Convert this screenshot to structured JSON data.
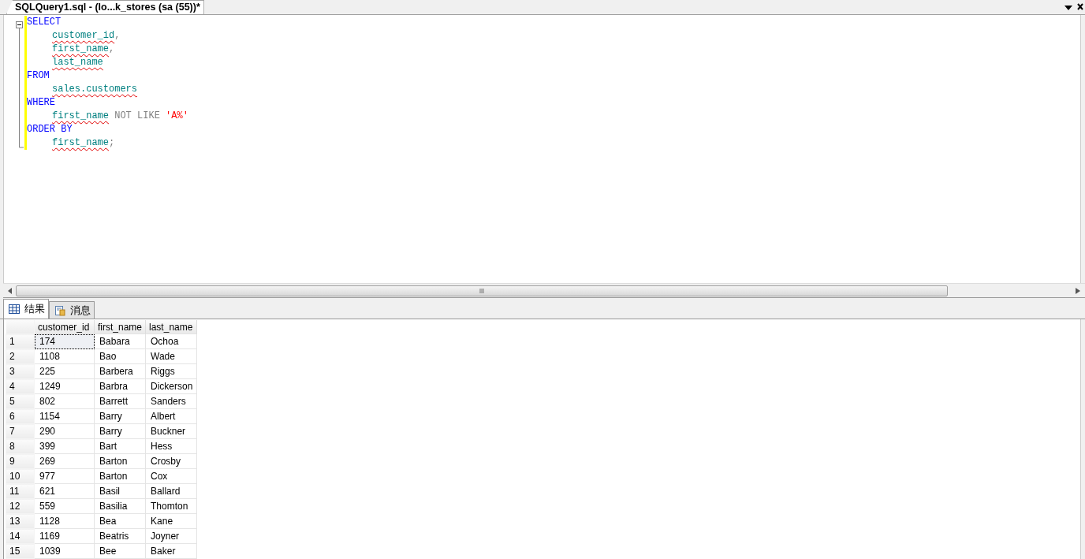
{
  "document_tab": {
    "title": "SQLQuery1.sql - (lo...k_stores (sa (55))*",
    "selected": true
  },
  "editor": {
    "lines": [
      {
        "tokens": [
          {
            "kind": "keyword",
            "text": "SELECT"
          }
        ],
        "children": [
          {
            "tokens": [
              {
                "kind": "identifier",
                "text": "customer_id"
              },
              {
                "kind": "punct",
                "text": ","
              }
            ]
          },
          {
            "tokens": [
              {
                "kind": "identifier",
                "text": "first_name"
              },
              {
                "kind": "punct",
                "text": ","
              }
            ]
          },
          {
            "tokens": [
              {
                "kind": "identifier",
                "text": "last_name"
              }
            ]
          }
        ]
      },
      {
        "tokens": [
          {
            "kind": "keyword",
            "text": "FROM"
          }
        ],
        "children": [
          {
            "tokens": [
              {
                "kind": "identifier",
                "text": "sales.customers"
              }
            ]
          }
        ]
      },
      {
        "tokens": [
          {
            "kind": "keyword",
            "text": "WHERE"
          }
        ],
        "children": [
          {
            "tokens": [
              {
                "kind": "identifier",
                "text": "first_name"
              },
              {
                "kind": "operator",
                "text": " NOT LIKE "
              },
              {
                "kind": "string",
                "text": "'A%'"
              }
            ]
          }
        ]
      },
      {
        "tokens": [
          {
            "kind": "keyword",
            "text": "ORDER BY"
          }
        ],
        "children": [
          {
            "tokens": [
              {
                "kind": "identifier",
                "text": "first_name"
              },
              {
                "kind": "punct",
                "text": ";"
              }
            ]
          }
        ]
      }
    ]
  },
  "result_tabs": [
    {
      "label": "结果",
      "selected": true,
      "kind": "grid"
    },
    {
      "label": "消息",
      "selected": false,
      "kind": "messages"
    }
  ],
  "table": {
    "columns": [
      "customer_id",
      "first_name",
      "last_name"
    ],
    "rows": [
      {
        "number": "1",
        "cells": [
          "174",
          "Babara",
          "Ochoa"
        ],
        "focused": true
      },
      {
        "number": "2",
        "cells": [
          "1108",
          "Bao",
          "Wade"
        ],
        "focused": false
      },
      {
        "number": "3",
        "cells": [
          "225",
          "Barbera",
          "Riggs"
        ],
        "focused": false
      },
      {
        "number": "4",
        "cells": [
          "1249",
          "Barbra",
          "Dickerson"
        ],
        "focused": false
      },
      {
        "number": "5",
        "cells": [
          "802",
          "Barrett",
          "Sanders"
        ],
        "focused": false
      },
      {
        "number": "6",
        "cells": [
          "1154",
          "Barry",
          "Albert"
        ],
        "focused": false
      },
      {
        "number": "7",
        "cells": [
          "290",
          "Barry",
          "Buckner"
        ],
        "focused": false
      },
      {
        "number": "8",
        "cells": [
          "399",
          "Bart",
          "Hess"
        ],
        "focused": false
      },
      {
        "number": "9",
        "cells": [
          "269",
          "Barton",
          "Crosby"
        ],
        "focused": false
      },
      {
        "number": "10",
        "cells": [
          "977",
          "Barton",
          "Cox"
        ],
        "focused": false
      },
      {
        "number": "11",
        "cells": [
          "621",
          "Basil",
          "Ballard"
        ],
        "focused": false
      },
      {
        "number": "12",
        "cells": [
          "559",
          "Basilia",
          "Thomton"
        ],
        "focused": false
      },
      {
        "number": "13",
        "cells": [
          "1128",
          "Bea",
          "Kane"
        ],
        "focused": false
      },
      {
        "number": "14",
        "cells": [
          "1169",
          "Beatris",
          "Joyner"
        ],
        "focused": false
      },
      {
        "number": "15",
        "cells": [
          "1039",
          "Bee",
          "Baker"
        ],
        "focused": false
      }
    ]
  }
}
